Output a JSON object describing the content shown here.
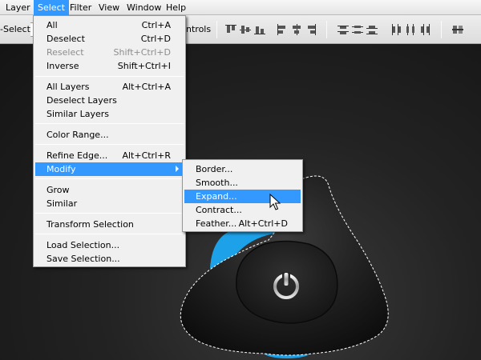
{
  "menubar": {
    "items": [
      {
        "label": "Layer"
      },
      {
        "label": "Select",
        "active": true
      },
      {
        "label": "Filter"
      },
      {
        "label": "View"
      },
      {
        "label": "Window"
      },
      {
        "label": "Help"
      }
    ]
  },
  "options_bar": {
    "auto_select_label": "-Select:",
    "show_controls_label": "ntrols"
  },
  "select_menu": {
    "items": [
      {
        "label": "All",
        "shortcut": "Ctrl+A"
      },
      {
        "label": "Deselect",
        "shortcut": "Ctrl+D"
      },
      {
        "label": "Reselect",
        "shortcut": "Shift+Ctrl+D",
        "disabled": true
      },
      {
        "label": "Inverse",
        "shortcut": "Shift+Ctrl+I"
      },
      {
        "label": "All Layers",
        "shortcut": "Alt+Ctrl+A"
      },
      {
        "label": "Deselect Layers",
        "shortcut": ""
      },
      {
        "label": "Similar Layers",
        "shortcut": ""
      },
      {
        "label": "Color Range...",
        "shortcut": ""
      },
      {
        "label": "Refine Edge...",
        "shortcut": "Alt+Ctrl+R"
      },
      {
        "label": "Modify",
        "shortcut": "",
        "highlighted": true,
        "submenu": true
      },
      {
        "label": "Grow",
        "shortcut": ""
      },
      {
        "label": "Similar",
        "shortcut": ""
      },
      {
        "label": "Transform Selection",
        "shortcut": ""
      },
      {
        "label": "Load Selection...",
        "shortcut": ""
      },
      {
        "label": "Save Selection...",
        "shortcut": ""
      }
    ]
  },
  "modify_menu": {
    "items": [
      {
        "label": "Border...",
        "shortcut": ""
      },
      {
        "label": "Smooth...",
        "shortcut": ""
      },
      {
        "label": "Expand...",
        "shortcut": "",
        "highlighted": true
      },
      {
        "label": "Contract...",
        "shortcut": ""
      },
      {
        "label": "Feather...",
        "shortcut": "Alt+Ctrl+D"
      }
    ]
  },
  "colors": {
    "highlight": "#3399ff",
    "accent_blue": "#1da1e8",
    "knob": "#1c1c1c"
  }
}
